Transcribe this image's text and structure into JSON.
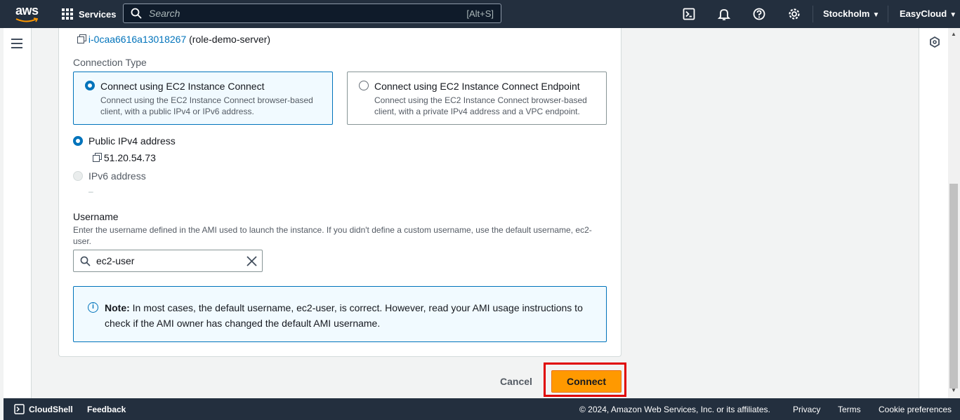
{
  "topnav": {
    "logo_text": "aws",
    "services_label": "Services",
    "search_placeholder": "Search",
    "search_shortcut": "[Alt+S]",
    "region": "Stockholm",
    "account": "EasyCloud"
  },
  "instance": {
    "id": "i-0caa6616a13018267",
    "name": "(role-demo-server)"
  },
  "connection_type": {
    "label": "Connection Type",
    "options": [
      {
        "title": "Connect using EC2 Instance Connect",
        "desc": "Connect using the EC2 Instance Connect browser-based client, with a public IPv4 or IPv6 address."
      },
      {
        "title": "Connect using EC2 Instance Connect Endpoint",
        "desc": "Connect using the EC2 Instance Connect browser-based client, with a private IPv4 address and a VPC endpoint."
      }
    ]
  },
  "address": {
    "ipv4_label": "Public IPv4 address",
    "ipv4_value": "51.20.54.73",
    "ipv6_label": "IPv6 address",
    "ipv6_value": "–"
  },
  "username": {
    "label": "Username",
    "description": "Enter the username defined in the AMI used to launch the instance. If you didn't define a custom username, use the default username, ec2-user.",
    "value": "ec2-user"
  },
  "note": {
    "prefix": "Note:",
    "text": " In most cases, the default username, ec2-user, is correct. However, read your AMI usage instructions to check if the AMI owner has changed the default AMI username."
  },
  "actions": {
    "cancel": "Cancel",
    "connect": "Connect"
  },
  "footer": {
    "cloudshell": "CloudShell",
    "feedback": "Feedback",
    "copyright": "© 2024, Amazon Web Services, Inc. or its affiliates.",
    "privacy": "Privacy",
    "terms": "Terms",
    "cookies": "Cookie preferences"
  },
  "colors": {
    "nav_bg": "#232f3e",
    "primary_button": "#ff9900",
    "link": "#0073bb",
    "highlight": "#e00000"
  }
}
